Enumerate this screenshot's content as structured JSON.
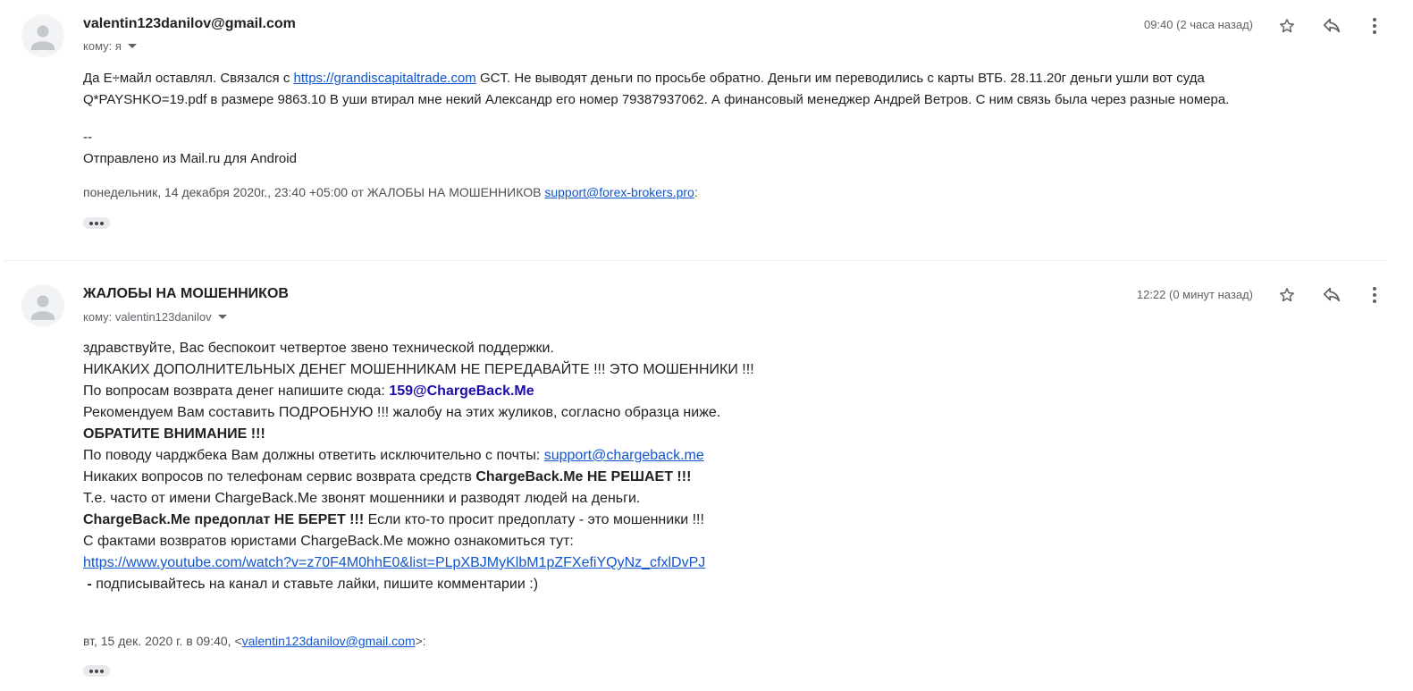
{
  "messages": [
    {
      "sender": "valentin123danilov@gmail.com",
      "to_label": "кому: я",
      "time": "09:40 (2 часа назад)",
      "body": {
        "line1_prefix": "Да Е÷майл оставлял. Связался с ",
        "line1_link": "https://grandiscapitaltrade.com",
        "line1_suffix": " GCT. Не выводят деньги по просьбе обратно. Деньги им переводились с карты ВТБ. 28.11.20г деньги ушли вот суда",
        "line2": "Q*PAYSHKO=19.pdf в размере 9863.10 В уши втирал мне некий Александр его номер 79387937062. А финансовый менеджер Андрей Ветров. С ним связь была через разные номера.",
        "sig_dashes": "--",
        "sig_text": "Отправлено из Mail.ru для Android"
      },
      "quote_prefix": "понедельник, 14 декабря 2020г., 23:40 +05:00 от ЖАЛОБЫ НА МОШЕННИКОВ ",
      "quote_link": "support@forex-brokers.pro",
      "quote_suffix": ":"
    },
    {
      "sender": "ЖАЛОБЫ НА МОШЕННИКОВ",
      "to_label": "кому: valentin123danilov",
      "time": "12:22 (0 минут назад)",
      "body": {
        "l1": "здравствуйте, Вас беспокоит четвертое звено технической поддержки.",
        "l2": "НИКАКИХ ДОПОЛНИТЕЛЬНЫХ ДЕНЕГ МОШЕННИКАМ НЕ ПЕРЕДАВАЙТЕ !!! ЭТО МОШЕННИКИ !!!",
        "l3_prefix": "По вопросам возврата денег напишите сюда: ",
        "l3_email": "159@ChargeBack.Me",
        "l4": "Рекомендуем Вам составить ПОДРОБНУЮ !!! жалобу на этих жуликов, согласно образца ниже.",
        "l5": "ОБРАТИТЕ ВНИМАНИЕ !!!",
        "l6_prefix": "По поводу чарджбека Вам должны ответить исключительно с почты: ",
        "l6_link": "support@chargeback.me",
        "l7_prefix": "Никаких вопросов по телефонам сервис возврата средств ",
        "l7_bold": "ChargeBack.Me НЕ РЕШАЕТ !!!",
        "l8": "Т.е. часто от имени ChargeBack.Me звонят мошенники и разводят людей на деньги.",
        "l9_bold": "ChargeBack.Me предоплат НЕ БЕРЕТ !!!",
        "l9_suffix": " Если кто-то просит предоплату - это мошенники !!!",
        "l10": "С фактами возвратов юристами ChargeBack.Me можно ознакомиться тут:",
        "l11_link": "https://www.youtube.com/watch?v=z70F4M0hhE0&list=PLpXBJMyKlbM1pZFXefiYQyNz_cfxlDvPJ",
        "l12_bold": " - ",
        "l12": "подписывайтесь на канал и ставьте лайки, пишите комментарии :)"
      },
      "quote_prefix": "вт, 15 дек. 2020 г. в 09:40, <",
      "quote_link": "valentin123danilov@gmail.com",
      "quote_suffix": ">:"
    }
  ]
}
